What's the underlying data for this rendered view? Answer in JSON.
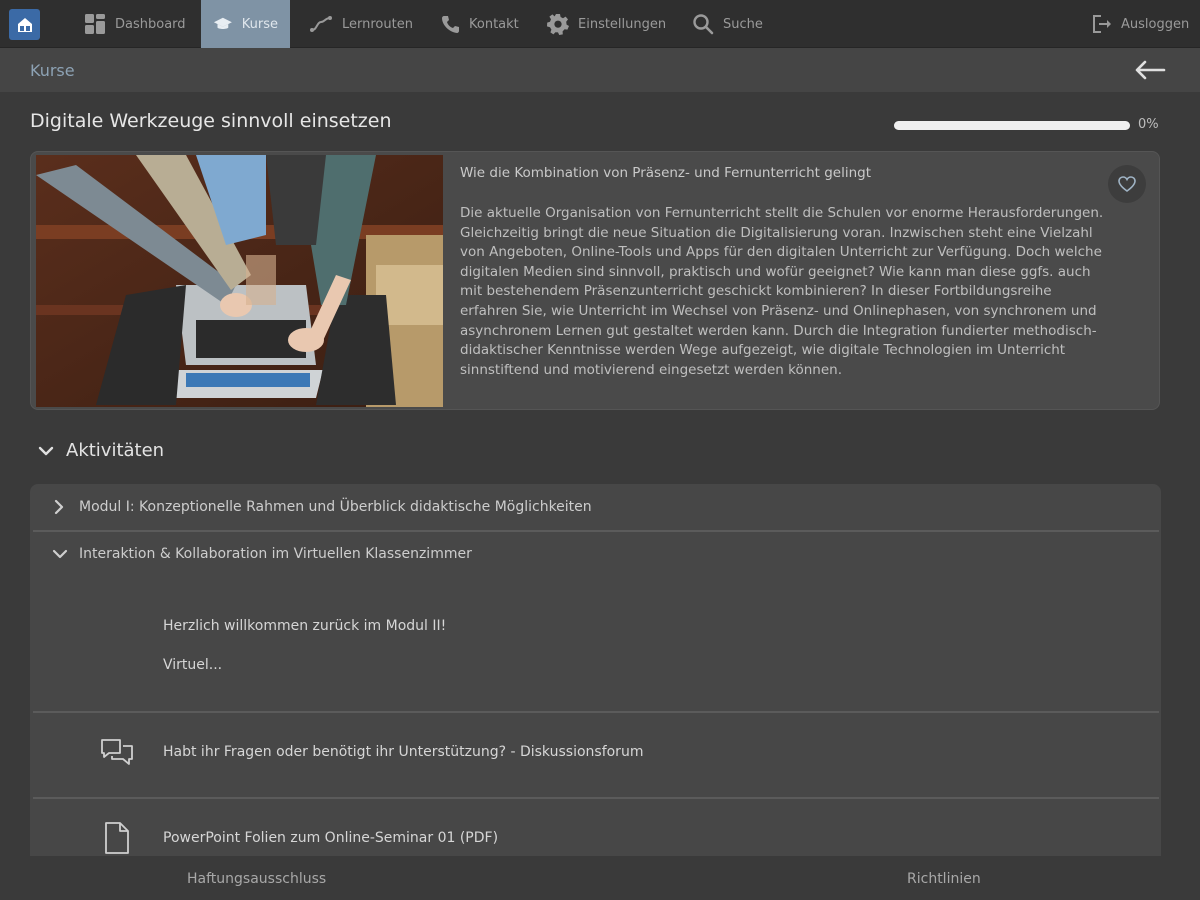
{
  "nav": {
    "items": [
      {
        "label": "Dashboard",
        "icon": "dashboard-icon"
      },
      {
        "label": "Kurse",
        "icon": "graduation-cap-icon",
        "active": true
      },
      {
        "label": "Lernrouten",
        "icon": "route-icon"
      },
      {
        "label": "Kontakt",
        "icon": "phone-icon"
      },
      {
        "label": "Einstellungen",
        "icon": "gear-icon"
      },
      {
        "label": "Suche",
        "icon": "search-icon"
      }
    ],
    "logout_label": "Ausloggen"
  },
  "breadcrumb": {
    "label": "Kurse"
  },
  "course": {
    "title": "Digitale Werkzeuge sinnvoll einsetzen",
    "progress_percent": 0,
    "progress_label": "0%",
    "subtitle": "Wie die Kombination von Präsenz- und Fernunterricht gelingt",
    "description": "Die aktuelle Organisation von Fernunterricht stellt die Schulen vor enorme Herausforderungen. Gleichzeitig bringt die neue Situation die Digitalisierung voran. Inzwischen steht eine Vielzahl von Angeboten, Online-Tools und Apps für den digitalen Unterricht zur Verfügung. Doch welche digitalen Medien sind sinnvoll, praktisch und wofür geeignet? Wie kann man diese ggfs. auch mit bestehendem Präsenzunterricht geschickt kombinieren? In dieser Fortbildungsreihe erfahren Sie, wie Unterricht im Wechsel von Präsenz- und Onlinephasen, von synchronem und asynchronem Lernen gut gestaltet werden kann. Durch die Integration fundierter methodisch-didaktischer Kenntnisse werden Wege aufgezeigt, wie digitale Technologien im Unterricht sinnstiftend und motivierend eingesetzt werden können."
  },
  "activities": {
    "header": "Aktivitäten",
    "modules": [
      {
        "label": "Modul I:  Konzeptionelle Rahmen und Überblick didaktische Möglichkeiten",
        "expanded": false
      },
      {
        "label": "Interaktion & Kollaboration im Virtuellen Klassenzimmer",
        "expanded": true
      }
    ],
    "welcome_text": "Herzlich willkommen zurück im Modul II!",
    "welcome_more": "Virtuel...",
    "items": [
      {
        "label": "Habt ihr Fragen oder benötigt ihr Unterstützung? - Diskussionsforum",
        "icon": "forum-icon"
      },
      {
        "label": "PowerPoint Folien zum Online-Seminar 01 (PDF)",
        "icon": "file-icon"
      }
    ]
  },
  "footer": {
    "disclaimer": "Haftungsausschluss",
    "guidelines": "Richtlinien"
  }
}
